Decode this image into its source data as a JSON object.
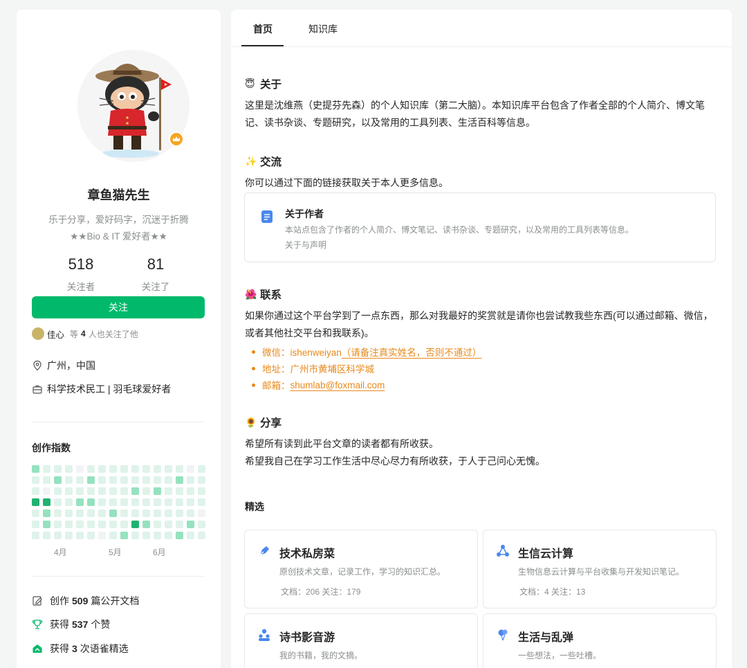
{
  "profile": {
    "name": "章鱼猫先生",
    "bio_line1": "乐于分享，爱好码字，沉迷于折腾",
    "bio_line2": "★★Bio & IT 爱好者★★",
    "followers_count": "518",
    "followers_label": "关注者",
    "following_count": "81",
    "following_label": "关注了",
    "follow_button": "关注",
    "mutual_name": "佳心",
    "mutual_prefix": "等",
    "mutual_count": "4",
    "mutual_suffix": "人也关注了他",
    "location": "广州，中国",
    "occupation": "科学技术民工 | 羽毛球爱好者",
    "heatmap_title": "创作指数",
    "heatmap_months": [
      "4月",
      "5月",
      "6月"
    ],
    "heatmap_levels": [
      [
        2,
        1,
        1,
        1,
        0,
        1,
        1,
        1,
        1,
        1,
        1,
        1,
        1,
        1,
        0,
        1
      ],
      [
        1,
        1,
        2,
        1,
        1,
        2,
        1,
        1,
        1,
        1,
        1,
        1,
        1,
        2,
        1,
        1
      ],
      [
        1,
        0,
        1,
        1,
        1,
        1,
        1,
        1,
        1,
        2,
        1,
        2,
        1,
        1,
        1,
        1
      ],
      [
        3,
        3,
        1,
        1,
        2,
        2,
        1,
        1,
        1,
        1,
        1,
        1,
        1,
        1,
        1,
        1
      ],
      [
        1,
        2,
        1,
        1,
        1,
        1,
        1,
        2,
        1,
        1,
        1,
        1,
        1,
        1,
        1,
        0
      ],
      [
        1,
        2,
        1,
        1,
        1,
        1,
        1,
        1,
        1,
        3,
        2,
        1,
        1,
        1,
        2,
        1
      ],
      [
        1,
        1,
        1,
        1,
        1,
        1,
        0,
        1,
        2,
        1,
        1,
        1,
        1,
        2,
        1,
        1
      ]
    ],
    "achievements": [
      {
        "prefix": "创作",
        "count": "509",
        "suffix": "篇公开文档"
      },
      {
        "prefix": "获得",
        "count": "537",
        "suffix": "个赞"
      },
      {
        "prefix": "获得",
        "count": "3",
        "suffix": "次语雀精选"
      }
    ],
    "colors": {
      "brand": "#00b96b",
      "heat0": "#f2f3f5",
      "heat1": "#dff3ea",
      "heat2": "#95e2bf",
      "heat3": "#1fb36f"
    }
  },
  "tabs": [
    "首页",
    "知识库"
  ],
  "main": {
    "about_heading": "关于",
    "about_icon": "angel-emoji",
    "about_text": "这里是沈维燕（史提芬先森）的个人知识库（第二大脑）。本知识库平台包含了作者全部的个人简介、博文笔记、读书杂谈、专题研究，以及常用的工具列表、生活百科等信息。",
    "exchange_heading": "交流",
    "exchange_icon": "sparkles-emoji",
    "exchange_text": "你可以通过下面的链接获取关于本人更多信息。",
    "card_title": "关于作者",
    "card_desc": "本站点包含了作者的个人简介、博文笔记、读书杂谈、专题研究，以及常用的工具列表等信息。",
    "card_meta": "关于与声明",
    "contact_heading": "联系",
    "contact_icon": "hibiscus-emoji",
    "contact_text": "如果你通过这个平台学到了一点东西，那么对我最好的奖赏就是请你也尝试教我些东西(可以通过邮箱、微信，或者其他社交平台和我联系)。",
    "contacts": {
      "wechat_label": "微信：ishenweiyan",
      "wechat_note": "（请备注真实姓名，否则不通过）",
      "address": "地址：广州市黄埔区科学城",
      "email_label": "邮箱：",
      "email": "shumlab@foxmail.com"
    },
    "share_heading": "分享",
    "share_icon": "sunflower-emoji",
    "share_line1": "希望所有读到此平台文章的读者都有所收获。",
    "share_line2": "希望我自己在学习工作生活中尽心尽力有所收获，于人于己问心无愧。",
    "featured_heading": "精选",
    "featured": [
      {
        "title": "技术私房菜",
        "desc": "原创技术文章，记录工作，学习的知识汇总。",
        "meta": "文档：206    关注：179",
        "icon": "pen-icon"
      },
      {
        "title": "生信云计算",
        "desc": "生物信息云计算与平台收集与开发知识笔记。",
        "meta": "文档：4    关注：13",
        "icon": "cloud-nodes-icon"
      },
      {
        "title": "诗书影音游",
        "desc": "我的书籍，我的文摘。",
        "meta": "",
        "icon": "people-icon"
      },
      {
        "title": "生活与乱弹",
        "desc": "一些想法，一些吐槽。",
        "meta": "",
        "icon": "balloon-icon"
      }
    ]
  }
}
